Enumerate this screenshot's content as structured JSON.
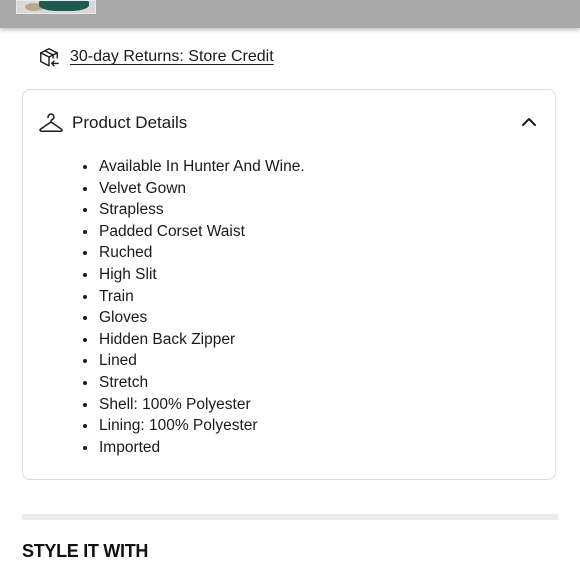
{
  "returns": {
    "icon": "package-return-icon",
    "label": "30-day Returns: Store Credit"
  },
  "product_details": {
    "icon": "hanger-icon",
    "title": "Product Details",
    "toggle_icon": "chevron-up-icon",
    "items": [
      "Available In Hunter And Wine.",
      "Velvet Gown",
      "Strapless",
      "Padded Corset Waist",
      "Ruched",
      "High Slit",
      "Train",
      "Gloves",
      "Hidden Back Zipper",
      "Lined",
      "Stretch",
      "Shell: 100% Polyester",
      "Lining: 100% Polyester",
      "Imported"
    ]
  },
  "style_it_with": {
    "heading": "STYLE IT WITH"
  },
  "colors": {
    "overlay_bar": "#a9a9a9",
    "text": "#1a1a1a",
    "border": "#dcdcdc"
  }
}
